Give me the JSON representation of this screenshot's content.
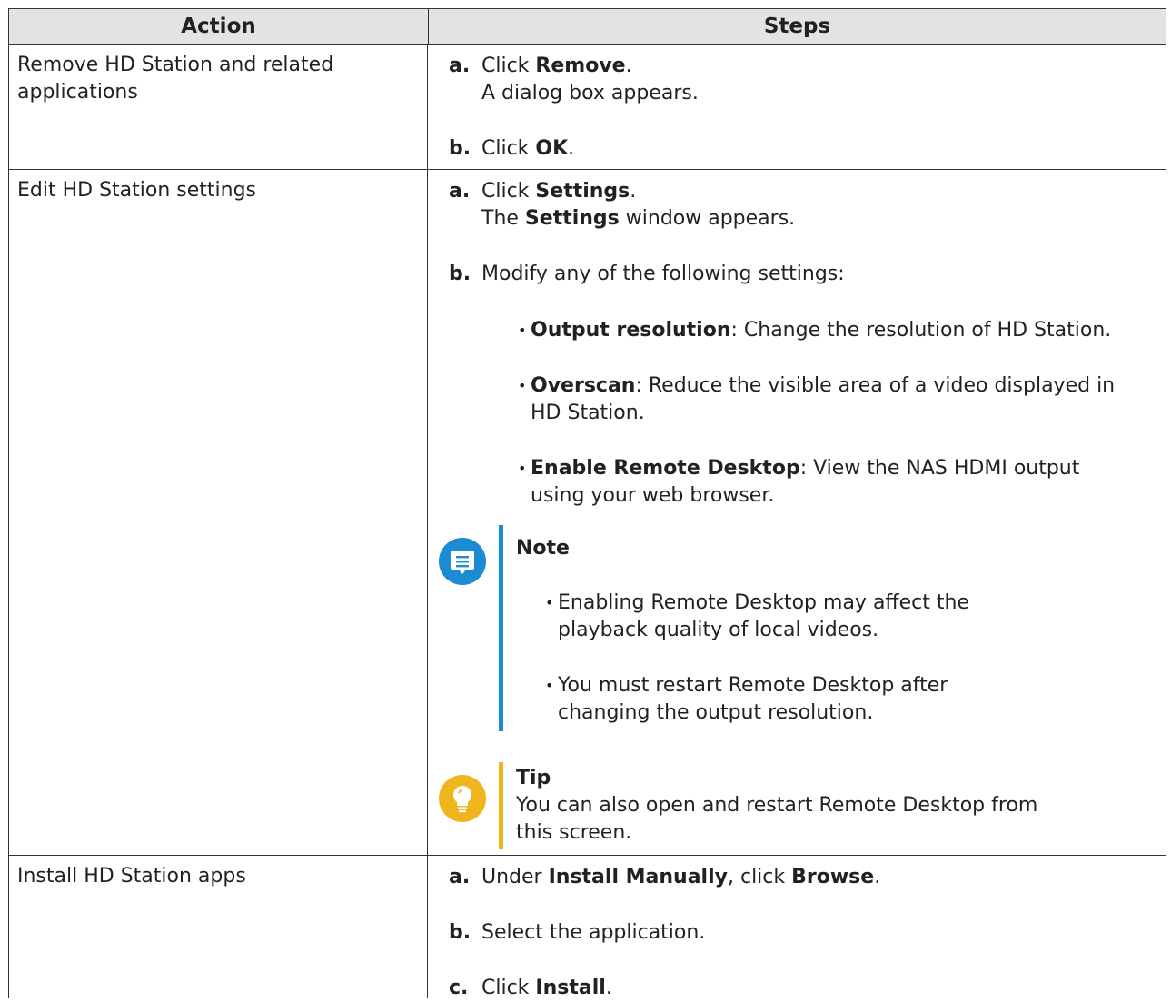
{
  "header": {
    "action": "Action",
    "steps": "Steps"
  },
  "rows": [
    {
      "action_line1": "Remove HD Station and related",
      "action_line2": "applications",
      "steps": {
        "a_label": "a.",
        "a_pre": "Click ",
        "a_bold": "Remove",
        "a_post": ".",
        "a_line2": "A dialog box appears.",
        "b_label": "b.",
        "b_pre": "Click ",
        "b_bold": "OK",
        "b_post": "."
      }
    },
    {
      "action": "Edit HD Station settings",
      "steps": {
        "a_label": "a.",
        "a_pre": "Click ",
        "a_bold": "Settings",
        "a_post": ".",
        "a2_pre": "The ",
        "a2_bold": "Settings",
        "a2_post": " window appears.",
        "b_label": "b.",
        "b_text": "Modify any of the following settings:",
        "bullets": [
          {
            "bold": "Output resolution",
            "rest": ": Change the resolution of HD Station."
          },
          {
            "bold": "Overscan",
            "rest": ": Reduce the visible area of a video displayed in",
            "line2": "HD Station."
          },
          {
            "bold": "Enable Remote Desktop",
            "rest": ": View the NAS HDMI output",
            "line2": "using your web browser."
          }
        ],
        "note": {
          "title": "Note",
          "items": [
            {
              "line1": "Enabling Remote Desktop may affect the",
              "line2": "playback quality of local videos."
            },
            {
              "line1": "You must restart Remote Desktop after",
              "line2": "changing the output resolution."
            }
          ]
        },
        "tip": {
          "title": "Tip",
          "line1": "You can also open and restart Remote Desktop from",
          "line2": "this screen."
        }
      }
    },
    {
      "action": "Install HD Station apps",
      "steps": {
        "a_label": "a.",
        "a_pre": "Under ",
        "a_bold1": "Install Manually",
        "a_mid": ", click ",
        "a_bold2": "Browse",
        "a_post": ".",
        "b_label": "b.",
        "b_text": "Select the application.",
        "c_label": "c.",
        "c_pre": "Click ",
        "c_bold": "Install",
        "c_post": "."
      }
    }
  ],
  "colors": {
    "note_accent": "#1b8bd2",
    "tip_accent": "#f0b41c",
    "header_bg": "#e3e3e3"
  },
  "icons": {
    "note": "note-bubble-icon",
    "tip": "lightbulb-icon"
  }
}
